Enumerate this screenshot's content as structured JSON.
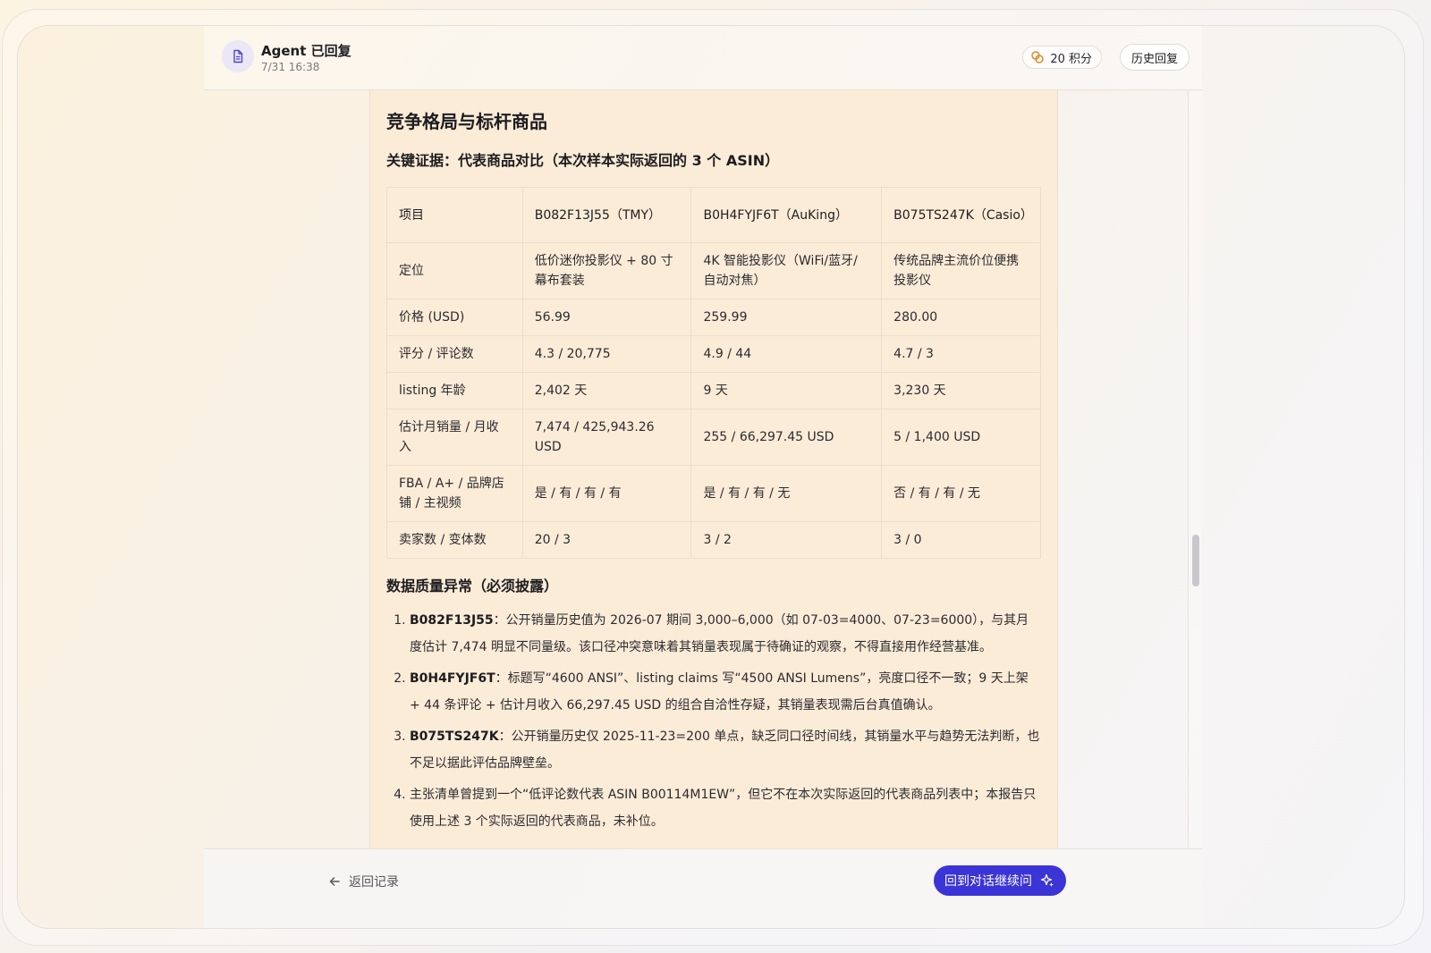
{
  "header": {
    "agent_title": "Agent 已回复",
    "timestamp": "7/31 16:38",
    "points_label": "20 积分",
    "history_label": "历史回复",
    "icons": {
      "agent": "document-icon",
      "points": "coins-icon"
    }
  },
  "doc": {
    "section_title": "竞争格局与标杆商品",
    "evidence_title": "关键证据：代表商品对比（本次样本实际返回的 3 个 ASIN）",
    "table": {
      "headers": [
        "项目",
        "B082F13J55（TMY）",
        "B0H4FYJF6T（AuKing）",
        "B075TS247K（Casio）"
      ],
      "rows": [
        [
          "定位",
          "低价迷你投影仪 + 80 寸幕布套装",
          "4K 智能投影仪（WiFi/蓝牙/自动对焦）",
          "传统品牌主流价位便携投影仪"
        ],
        [
          "价格 (USD)",
          "56.99",
          "259.99",
          "280.00"
        ],
        [
          "评分 / 评论数",
          "4.3 / 20,775",
          "4.9 / 44",
          "4.7 / 3"
        ],
        [
          "listing 年龄",
          "2,402 天",
          "9 天",
          "3,230 天"
        ],
        [
          "估计月销量 / 月收入",
          "7,474 / 425,943.26 USD",
          "255 / 66,297.45 USD",
          "5 / 1,400 USD"
        ],
        [
          "FBA / A+ / 品牌店铺 / 主视频",
          "是 / 有 / 有 / 有",
          "是 / 有 / 有 / 无",
          "否 / 有 / 有 / 无"
        ],
        [
          "卖家数 / 变体数",
          "20 / 3",
          "3 / 2",
          "3 / 0"
        ]
      ]
    },
    "dq_title": "数据质量异常（必须披露）",
    "dq_items": [
      {
        "key": "B082F13J55",
        "text": "：公开销量历史值为 2026-07 期间 3,000–6,000（如 07-03=4000、07-23=6000），与其月度估计 7,474 明显不同量级。该口径冲突意味着其销量表现属于待确证的观察，不得直接用作经营基准。"
      },
      {
        "key": "B0H4FYJF6T",
        "text": "：标题写“4600 ANSI”、listing claims 写“4500 ANSI Lumens”，亮度口径不一致；9 天上架 + 44 条评论 + 估计月收入 66,297.45 USD 的组合自洽性存疑，其销量表现需后台真值确认。"
      },
      {
        "key": "B075TS247K",
        "text": "：公开销量历史仅 2025-11-23=200 单点，缺乏同口径时间线，其销量水平与趋势无法判断，也不足以据此评估品牌壁垒。"
      },
      {
        "key": "",
        "text": "主张清单曾提到一个“低评论数代表 ASIN B00114M1EW”，但它不在本次实际返回的代表商品列表中；本报告只使用上述 3 个实际返回的代表商品，未补位。"
      }
    ]
  },
  "footer": {
    "back_label": "返回记录",
    "continue_label": "回到对话继续问",
    "icons": {
      "back": "arrow-left-icon",
      "continue": "sparkle-icon"
    }
  },
  "colors": {
    "accent": "#3b34d6",
    "doc_bg": "#fbecd8"
  }
}
